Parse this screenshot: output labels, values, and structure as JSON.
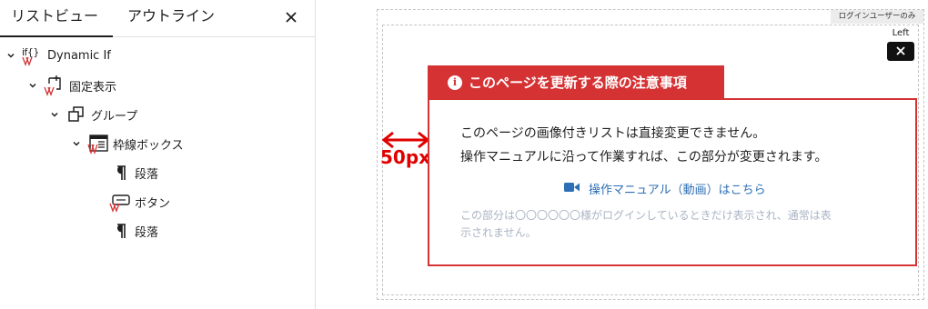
{
  "tabs": {
    "list_view": "リストビュー",
    "outline": "アウトライン"
  },
  "tree": {
    "dynamic_if": "Dynamic If",
    "fixed_display": "固定表示",
    "group": "グループ",
    "bordered_box": "枠線ボックス",
    "paragraph_1": "段落",
    "button": "ボタン",
    "paragraph_2": "段落",
    "if_glyph": "if{}"
  },
  "canvas": {
    "login_badge": "ログインユーザーのみ",
    "left_label": "Left",
    "spacing_label": "50px",
    "title": "このページを更新する際の注意事項",
    "line1": "このページの画像付きリストは直接変更できません。",
    "line2": "操作マニュアルに沿って作業すれば、この部分が変更されます。",
    "manual_link": "操作マニュアル（動画）はこちら",
    "gray1": "この部分は〇〇〇〇〇〇様がログインしているときだけ表示され、通常は表",
    "gray2": "示されません。"
  },
  "colors": {
    "accent_red": "#d53234",
    "link_blue": "#2c6fb5",
    "muted_gray": "#aab4c4"
  }
}
